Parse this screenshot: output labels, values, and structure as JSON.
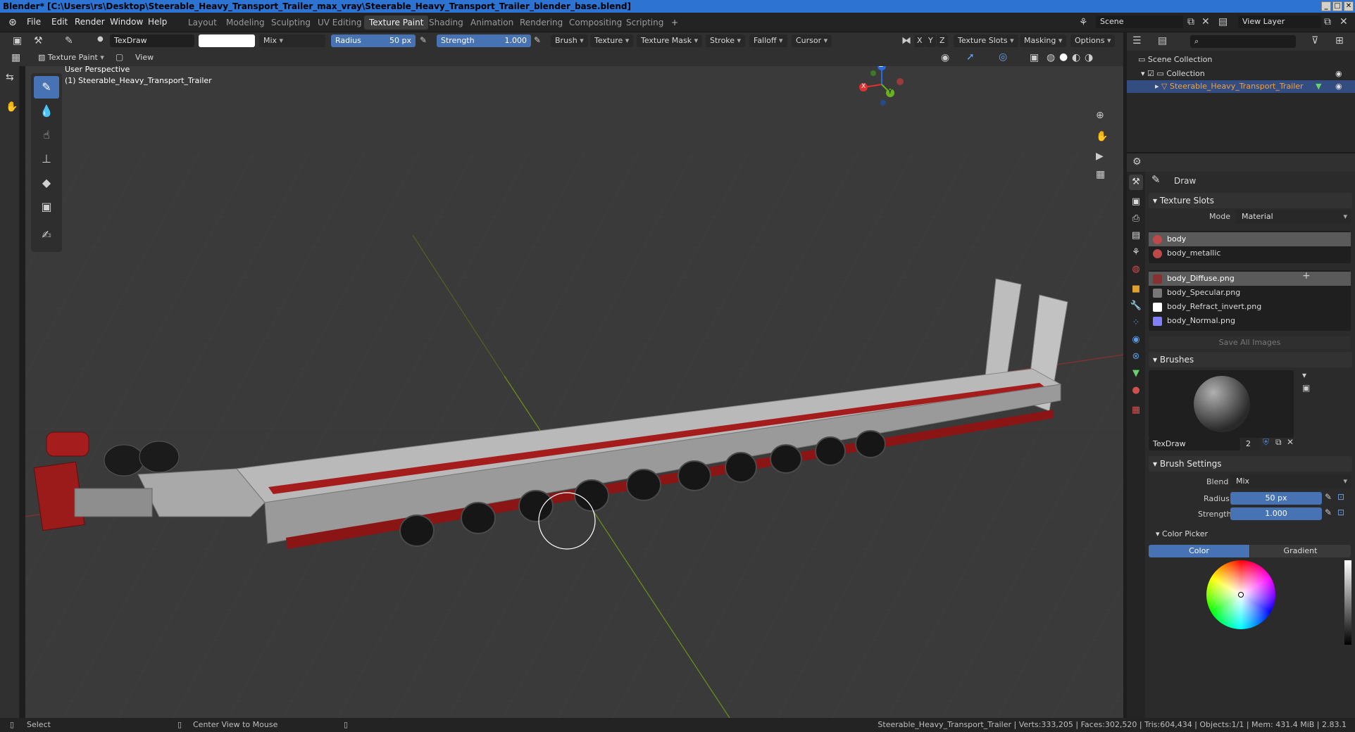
{
  "window": {
    "title": "Blender* [C:\\Users\\rs\\Desktop\\Steerable_Heavy_Transport_Trailer_max_vray\\Steerable_Heavy_Transport_Trailer_blender_base.blend]",
    "min": "_",
    "max": "□",
    "close": "✕"
  },
  "menu": [
    "File",
    "Edit",
    "Render",
    "Window",
    "Help"
  ],
  "workspaces": [
    "Layout",
    "Modeling",
    "Sculpting",
    "UV Editing",
    "Texture Paint",
    "Shading",
    "Animation",
    "Rendering",
    "Compositing",
    "Scripting"
  ],
  "workspace_add": "+",
  "scene": {
    "label": "Scene",
    "view_layer": "View Layer"
  },
  "header": {
    "brush_name": "TexDraw",
    "blend": "Mix",
    "radius_label": "Radius",
    "radius_value": "50 px",
    "strength_label": "Strength",
    "strength_value": "1.000",
    "brush": "Brush",
    "texture": "Texture",
    "texture_mask": "Texture Mask",
    "stroke": "Stroke",
    "falloff": "Falloff",
    "cursor": "Cursor",
    "axes": [
      "X",
      "Y",
      "Z"
    ],
    "texture_slots": "Texture Slots",
    "masking": "Masking",
    "options": "Options"
  },
  "header2": {
    "mode": "Texture Paint",
    "view": "View"
  },
  "viewport": {
    "perspective": "User Perspective",
    "object": "(1) Steerable_Heavy_Transport_Trailer"
  },
  "gizmo": {
    "z": "Z",
    "y": "Y",
    "x": "X"
  },
  "outliner": {
    "scene_collection": "Scene Collection",
    "collection": "Collection",
    "object": "Steerable_Heavy_Transport_Trailer"
  },
  "properties": {
    "tool": "Draw",
    "texture_slots_title": "Texture Slots",
    "mode_label": "Mode",
    "mode_value": "Material",
    "materials": [
      "body",
      "body_metallic"
    ],
    "images": [
      {
        "name": "body_Diffuse.png",
        "color": "#8a3030"
      },
      {
        "name": "body_Specular.png",
        "color": "#777777"
      },
      {
        "name": "body_Refract_invert.png",
        "color": "#ffffff"
      },
      {
        "name": "body_Normal.png",
        "color": "#8080ff"
      }
    ],
    "save_all": "Save All Images",
    "brushes_title": "Brushes",
    "brush_name": "TexDraw",
    "brush_users": "2",
    "brush_settings_title": "Brush Settings",
    "blend_label": "Blend",
    "blend_value": "Mix",
    "radius_label": "Radius",
    "radius_value": "50 px",
    "strength_label": "Strength",
    "strength_value": "1.000",
    "color_picker_title": "Color Picker",
    "color_tab": "Color",
    "gradient_tab": "Gradient"
  },
  "status": {
    "select": "Select",
    "center": "Center View to Mouse",
    "stats": "Steerable_Heavy_Transport_Trailer | Verts:333,205 | Faces:302,520 | Tris:604,434 | Objects:1/1 | Mem: 431.4 MiB | 2.83.1"
  },
  "colors": {
    "accent": "#4772b3",
    "titlebar": "#2c73d2",
    "trailer_red": "#a01818",
    "trailer_deck": "#b8b8b8"
  }
}
